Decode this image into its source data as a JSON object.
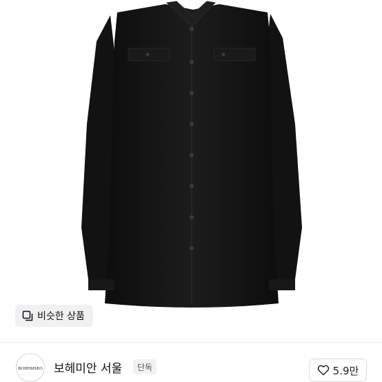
{
  "similar_products": {
    "icon": "similar-items-icon",
    "label": "비슷한 상품"
  },
  "store": {
    "logo_text": "BOHEMSEO",
    "name": "보헤미안 서울",
    "badge": "단독"
  },
  "like": {
    "icon": "heart-icon",
    "count": "5.9만"
  },
  "colors": {
    "garment": "#141414",
    "background": "#ffffff",
    "chip_bg": "#f1f1f3"
  }
}
